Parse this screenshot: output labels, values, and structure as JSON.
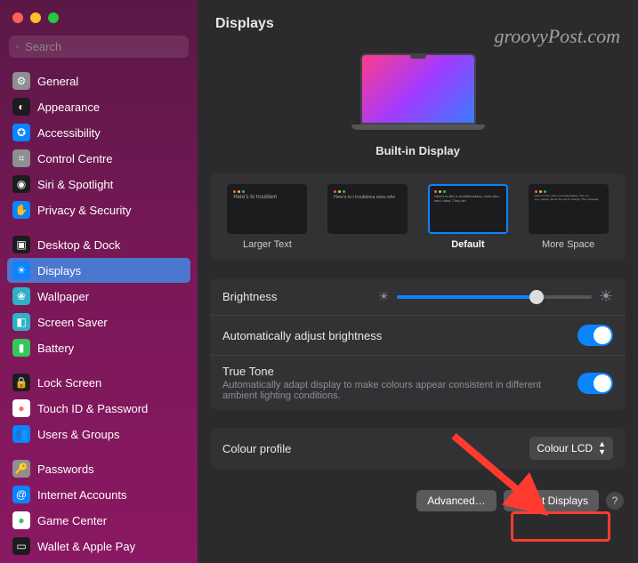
{
  "watermark": "groovyPost.com",
  "search": {
    "placeholder": "Search"
  },
  "sidebar": {
    "items": [
      {
        "label": "General",
        "bg": "#8e8e93",
        "glyph": "⚙"
      },
      {
        "label": "Appearance",
        "bg": "#1c1c1e",
        "glyph": "◐"
      },
      {
        "label": "Accessibility",
        "bg": "#0a84ff",
        "glyph": "✪"
      },
      {
        "label": "Control Centre",
        "bg": "#8e8e93",
        "glyph": "⌗"
      },
      {
        "label": "Siri & Spotlight",
        "bg": "#1c1c1e",
        "glyph": "◉"
      },
      {
        "label": "Privacy & Security",
        "bg": "#0a84ff",
        "glyph": "✋"
      },
      {
        "label": "Desktop & Dock",
        "bg": "#1c1c1e",
        "glyph": "▣"
      },
      {
        "label": "Displays",
        "bg": "#0a84ff",
        "glyph": "☀"
      },
      {
        "label": "Wallpaper",
        "bg": "#30b0c7",
        "glyph": "❀"
      },
      {
        "label": "Screen Saver",
        "bg": "#30b0c7",
        "glyph": "◧"
      },
      {
        "label": "Battery",
        "bg": "#34c759",
        "glyph": "▮"
      },
      {
        "label": "Lock Screen",
        "bg": "#1c1c1e",
        "glyph": "🔒"
      },
      {
        "label": "Touch ID & Password",
        "bg": "#fff",
        "glyph": "●",
        "fg": "#ff6b6b"
      },
      {
        "label": "Users & Groups",
        "bg": "#0a84ff",
        "glyph": "👥"
      },
      {
        "label": "Passwords",
        "bg": "#8e8e93",
        "glyph": "🔑"
      },
      {
        "label": "Internet Accounts",
        "bg": "#0a84ff",
        "glyph": "@"
      },
      {
        "label": "Game Center",
        "bg": "#fff",
        "glyph": "●",
        "fg": "#34c759"
      },
      {
        "label": "Wallet & Apple Pay",
        "bg": "#1c1c1e",
        "glyph": "▭"
      }
    ],
    "selectedIndex": 7,
    "separatorsAfter": [
      5,
      10,
      13
    ]
  },
  "main": {
    "title": "Displays",
    "displayName": "Built-in Display",
    "resolutions": {
      "options": [
        {
          "label": "Larger Text",
          "preview": "Here's to troublem"
        },
        {
          "label": "",
          "preview": "Here's to t troublema ones who"
        },
        {
          "label": "Default",
          "preview": "Here's to the cr troublemakers, ones who see t rules. They wh"
        },
        {
          "label": "More Space",
          "preview": "Here's to the crazy on troublemakers. The rou peg...design. About the only th change. They changed"
        }
      ],
      "selectedIndex": 2
    },
    "brightness": {
      "label": "Brightness",
      "value": 72
    },
    "autoBrightness": {
      "label": "Automatically adjust brightness",
      "on": true
    },
    "trueTone": {
      "label": "True Tone",
      "sub": "Automatically adapt display to make colours appear consistent in different ambient lighting conditions.",
      "on": true
    },
    "colourProfile": {
      "label": "Colour profile",
      "value": "Colour LCD"
    },
    "footer": {
      "advanced": "Advanced…",
      "detect": "Detect Displays",
      "help": "?"
    }
  }
}
